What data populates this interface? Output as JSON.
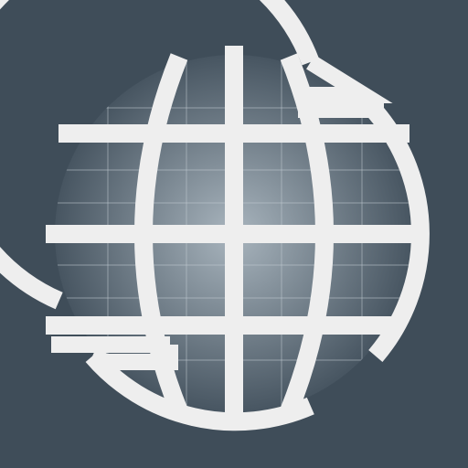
{
  "icon": {
    "name": "globe-icon",
    "colors": {
      "background": "#3f4d59",
      "globe_center": "#a9b5be",
      "globe_edge": "#475561",
      "grid_lines": "#c3ccd3",
      "frame": "#eeeeee"
    }
  }
}
